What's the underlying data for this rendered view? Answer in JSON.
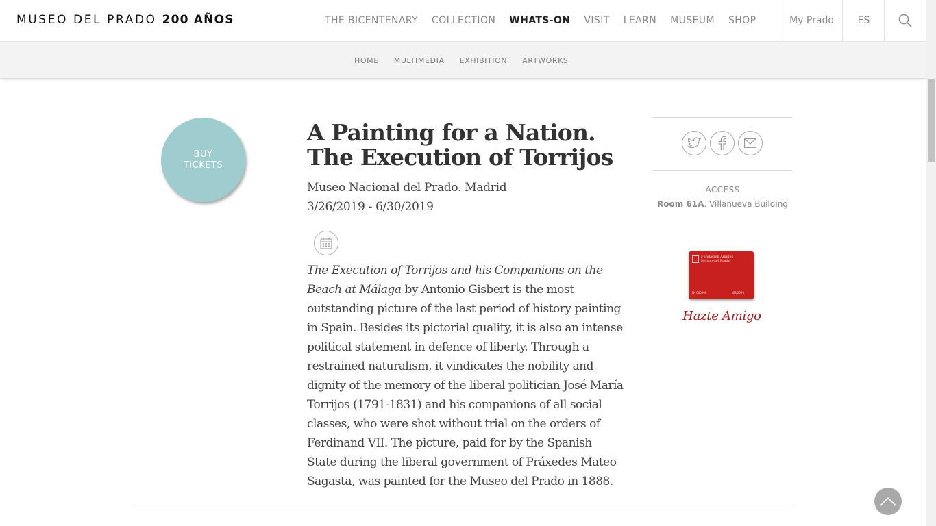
{
  "header": {
    "logo_text": "MUSEO DEL PRADO",
    "logo_bold": "200 AÑOS",
    "nav": [
      {
        "label": "THE BICENTENARY"
      },
      {
        "label": "COLLECTION"
      },
      {
        "label": "WHATS-ON"
      },
      {
        "label": "VISIT"
      },
      {
        "label": "LEARN"
      },
      {
        "label": "MUSEUM"
      },
      {
        "label": "SHOP"
      }
    ],
    "active_nav": "WHATS-ON",
    "my_prado": "My Prado",
    "language": "ES",
    "search_icon": "search-icon"
  },
  "subnav": [
    {
      "label": "HOME"
    },
    {
      "label": "MULTIMEDIA"
    },
    {
      "label": "EXHIBITION"
    },
    {
      "label": "ARTWORKS"
    }
  ],
  "buy": {
    "line1": "BUY",
    "line2": "TICKETS",
    "color": "#9fccce"
  },
  "exhibition": {
    "title": "A Painting for a Nation. The Execution of Torrijos",
    "venue": "Museo Nacional del Prado. Madrid",
    "dates": "3/26/2019 - 6/30/2019",
    "calendar_icon": "calendar-icon",
    "description_italic": "The Execution of Torrijos and his Companions on the Beach at Málaga",
    "description_rest": " by Antonio Gisbert is the most outstanding picture of the last period of history painting in Spain. Besides its pictorial quality, it is also an intense political statement in defence of liberty. Through a restrained naturalism, it vindicates the nobility and dignity of the memory of the liberal politician José María Torrijos (1791-1831) and his companions of all social classes, who were shot without trial on the orders of Ferdinand VII. The picture, paid for by the Spanish State during the liberal government of Práxedes Mateo Sagasta, was painted for the Museo del Prado in 1888."
  },
  "share": [
    "twitter-icon",
    "facebook-icon",
    "email-icon"
  ],
  "access": {
    "label": "ACCESS",
    "room": "Room 61A",
    "building": ". Villanueva Building"
  },
  "card": {
    "line1": "Fundación Amigos",
    "line2": "Museo del Prado",
    "number": "Nº 000000",
    "expiry": "MM/2020",
    "color": "#c8201f"
  },
  "amigo_link": "Hazte Amigo",
  "back_to_top_icon": "arrow-up-icon"
}
